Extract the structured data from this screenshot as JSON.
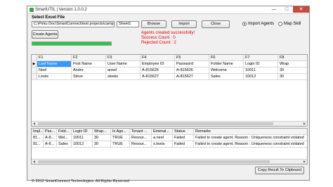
{
  "window": {
    "title": "SmartUTIL | Version 1.0.0.2"
  },
  "window_buttons": {
    "minimize": "—",
    "maximize": "□",
    "close": "✕"
  },
  "form": {
    "select_excel_label": "Select Excel File",
    "file_path": "C:\\Pintu Doc\\SmartConnect\\test projects\\campa",
    "sheet_name": "Sheet1",
    "browse_label": "Browse",
    "import_label": "Import",
    "close_label": "Close",
    "import_agents_label": "Import Agents",
    "map_skill_label": "Map Skill",
    "create_agents_label": "Create Agents",
    "progress": 1.0
  },
  "messages": {
    "created": "Agents created successfully!",
    "success": "Success Count : 0",
    "rejected": "Rejected Count : 2"
  },
  "top_grid": {
    "headers": [
      "F1",
      "F2",
      "F3",
      "F4",
      "F5",
      "F6",
      "F7",
      "F8"
    ],
    "rows": [
      [
        "Last Name",
        "First Name",
        "User Name",
        "Employee ID",
        "Password",
        "Folder Name",
        "Login ID",
        "Wrap"
      ],
      [
        "Neel",
        "Andre",
        "aneel",
        "A-815626",
        "A-815626",
        "Welcome",
        "10011",
        "30"
      ],
      [
        "Lewis",
        "Steve",
        "slewis",
        "A-815627",
        "A-815627",
        "Sales",
        "10012",
        "30"
      ]
    ]
  },
  "bottom_grid": {
    "headers": [
      "Impl...",
      "Pas...",
      "Fold...",
      "Login ID",
      "Wrap...",
      "Is Age...",
      "Tenant ...",
      "Extenal...",
      "Status",
      "Remarks"
    ],
    "rows": [
      [
        "81...",
        "A-8...",
        "Wel...",
        "10011",
        "30",
        "TRUE",
        "Resour...",
        "a.neel",
        "Failed",
        "Failed to create agent. Reason : Uniqueness constraint violated"
      ],
      [
        "81...",
        "A-8...",
        "Sales",
        "10012",
        "30",
        "TRUE",
        "Resour...",
        "s.lewis",
        "Failed",
        "Failed to create agent. Reason : Uniqueness constraint violated"
      ]
    ]
  },
  "copy_button_label": "Copy Result To Clipboard",
  "footer": "© 2012 SmartConnect Technologies. All Rights Reserved",
  "row_marker": "▶",
  "scroll_left": "◀",
  "scroll_right": "▶",
  "icons": {
    "app": "app-icon"
  },
  "colors": {
    "accent_green": "#27c93f",
    "message_red": "#e00000",
    "selection_blue": "#3399ff",
    "close_red": "#c84a3e"
  }
}
